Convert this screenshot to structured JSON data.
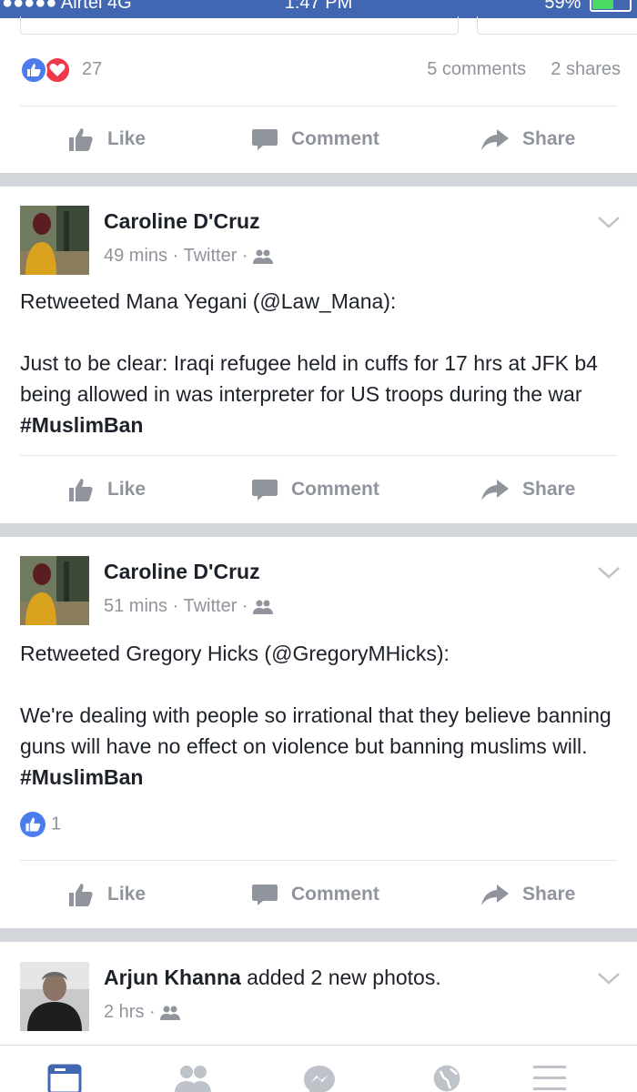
{
  "status_bar": {
    "carrier": "●●●●● Airtel  4G",
    "time": "1:47 PM",
    "battery": "59%"
  },
  "prev_post": {
    "reaction_count": "27",
    "comments": "5 comments",
    "shares": "2 shares"
  },
  "actions": {
    "like": "Like",
    "comment": "Comment",
    "share": "Share"
  },
  "posts": [
    {
      "author": "Caroline D'Cruz",
      "time": "49 mins",
      "source": "Twitter",
      "retweet_line": "Retweeted Mana Yegani (@Law_Mana):",
      "body": "Just to be clear: Iraqi refugee held in cuffs for 17 hrs at JFK b4 being allowed in was interpreter for US troops during the war",
      "hashtag": "#MuslimBan"
    },
    {
      "author": "Caroline D'Cruz",
      "time": "51 mins",
      "source": "Twitter",
      "retweet_line": "Retweeted Gregory Hicks (@GregoryMHicks):",
      "body": "We're dealing with people so irrational that they believe banning guns will have no effect on violence but banning muslims will.",
      "hashtag": "#MuslimBan",
      "like_count": "1"
    },
    {
      "author": "Arjun Khanna",
      "action": "added 2 new photos.",
      "time": "2 hrs"
    }
  ],
  "meta_sep": " · ",
  "colors": {
    "brand": "#4267b2",
    "like_blue": "#4b7bec",
    "love_red": "#f0384c",
    "muted": "#90949c"
  },
  "tabs": [
    "news-feed-icon",
    "friends-icon",
    "messenger-icon",
    "notifications-globe-icon",
    "menu-icon"
  ]
}
